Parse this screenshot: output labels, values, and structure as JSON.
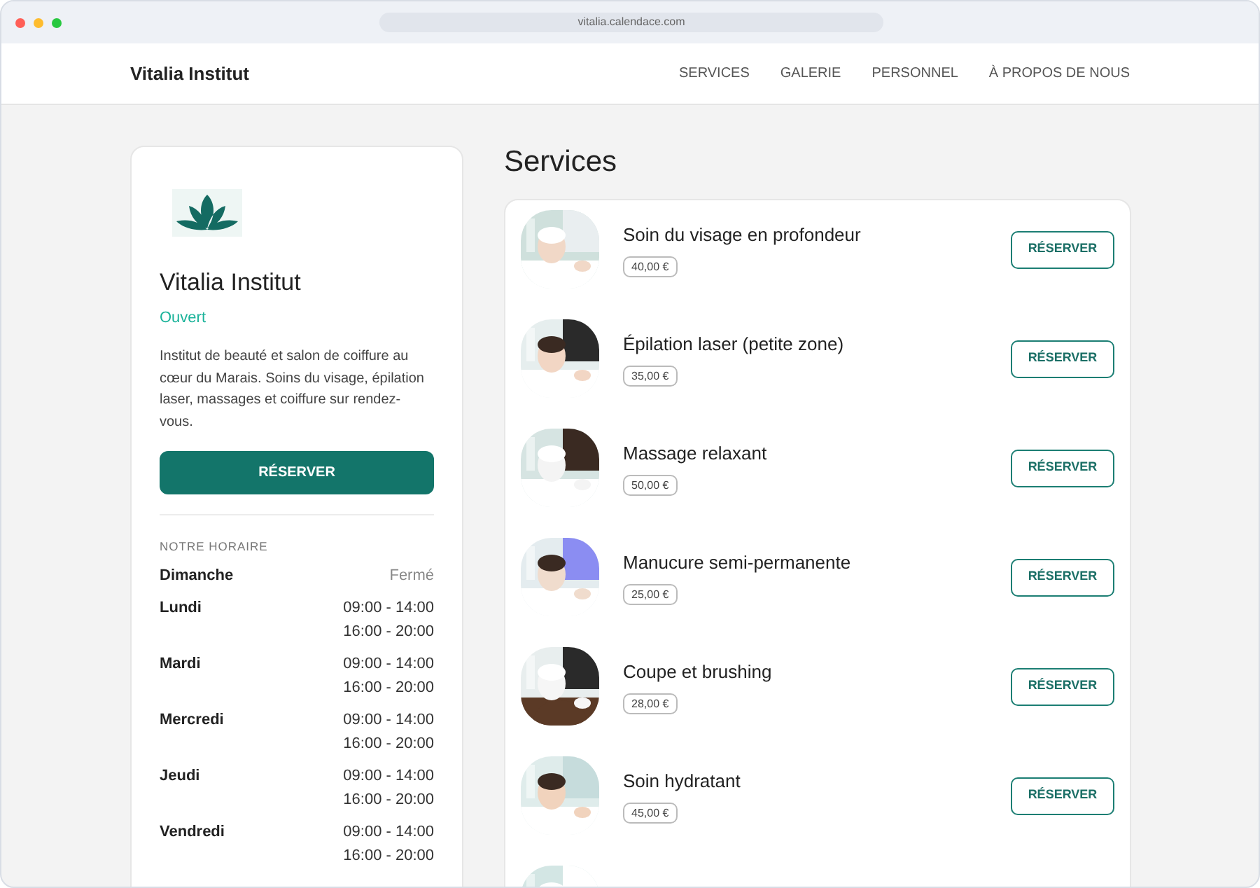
{
  "browser": {
    "url": "vitalia.calendace.com"
  },
  "nav": {
    "brand": "Vitalia Institut",
    "links": [
      "SERVICES",
      "GALERIE",
      "PERSONNEL",
      "À PROPOS DE NOUS"
    ]
  },
  "profile": {
    "name": "Vitalia Institut",
    "status": "Ouvert",
    "description": "Institut de beauté et salon de coiffure au cœur du Marais. Soins du visage, épilation laser, massages et coiffure sur rendez-vous.",
    "button": "RÉSERVER"
  },
  "hours": {
    "title": "NOTRE HORAIRE",
    "days": [
      {
        "day": "Dimanche",
        "closed": true,
        "times": [
          "Fermé"
        ]
      },
      {
        "day": "Lundi",
        "closed": false,
        "times": [
          "09:00 - 14:00",
          "16:00 - 20:00"
        ]
      },
      {
        "day": "Mardi",
        "closed": false,
        "times": [
          "09:00 - 14:00",
          "16:00 - 20:00"
        ]
      },
      {
        "day": "Mercredi",
        "closed": false,
        "times": [
          "09:00 - 14:00",
          "16:00 - 20:00"
        ]
      },
      {
        "day": "Jeudi",
        "closed": false,
        "times": [
          "09:00 - 14:00",
          "16:00 - 20:00"
        ]
      },
      {
        "day": "Vendredi",
        "closed": false,
        "times": [
          "09:00 - 14:00",
          "16:00 - 20:00"
        ]
      }
    ]
  },
  "services": {
    "title": "Services",
    "items": [
      {
        "kind": "service",
        "name": "Soin du visage en profondeur",
        "price": "40,00 €",
        "button": "RÉSERVER"
      },
      {
        "kind": "service",
        "name": "Épilation laser (petite zone)",
        "price": "35,00 €",
        "button": "RÉSERVER"
      },
      {
        "kind": "service",
        "name": "Massage relaxant",
        "price": "50,00 €",
        "button": "RÉSERVER"
      },
      {
        "kind": "service",
        "name": "Manucure semi-permanente",
        "price": "25,00 €",
        "button": "RÉSERVER"
      },
      {
        "kind": "service",
        "name": "Coupe et brushing",
        "price": "28,00 €",
        "button": "RÉSERVER"
      },
      {
        "kind": "service",
        "name": "Soin hydratant",
        "price": "45,00 €",
        "button": "RÉSERVER"
      },
      {
        "kind": "picture"
      }
    ]
  }
}
